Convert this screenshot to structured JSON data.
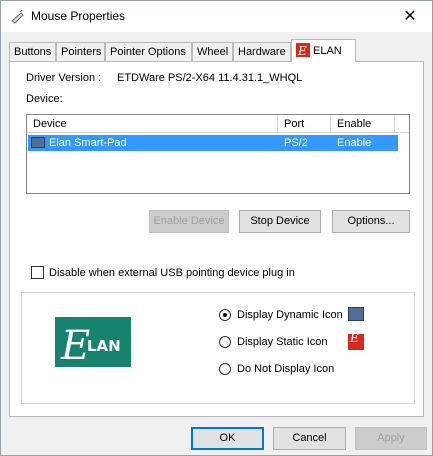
{
  "window": {
    "title": "Mouse Properties",
    "close_glyph": "✕",
    "title_icon": "mouse-icon"
  },
  "tabs": [
    {
      "label": "Buttons"
    },
    {
      "label": "Pointers"
    },
    {
      "label": "Pointer Options"
    },
    {
      "label": "Wheel"
    },
    {
      "label": "Hardware"
    },
    {
      "label": "ELAN",
      "active": true,
      "icon": "elan-icon"
    }
  ],
  "driver": {
    "label": "Driver Version :",
    "value": "ETDWare PS/2-X64 11.4.31.1_WHQL"
  },
  "device": {
    "label": "Device:",
    "columns": [
      "Device",
      "Port",
      "Enable"
    ],
    "rows": [
      {
        "device": "Elan Smart-Pad",
        "port": "PS/2",
        "enable": "Enable",
        "selected": true
      }
    ]
  },
  "device_buttons": {
    "enable": "Enable Device",
    "stop": "Stop Device",
    "options": "Options..."
  },
  "usb_checkbox": {
    "label": "Disable when external USB pointing device plug in",
    "checked": false
  },
  "tray_options": {
    "logo_text": "LAN",
    "logo_letter": "E",
    "dynamic": "Display Dynamic Icon",
    "static": "Display Static Icon",
    "none": "Do Not Display Icon",
    "selected": "dynamic"
  },
  "dialog_buttons": {
    "ok": "OK",
    "cancel": "Cancel",
    "apply": "Apply"
  },
  "colors": {
    "selection": "#3399ff",
    "elan_green": "#17836f",
    "elan_red": "#d42b1c"
  }
}
